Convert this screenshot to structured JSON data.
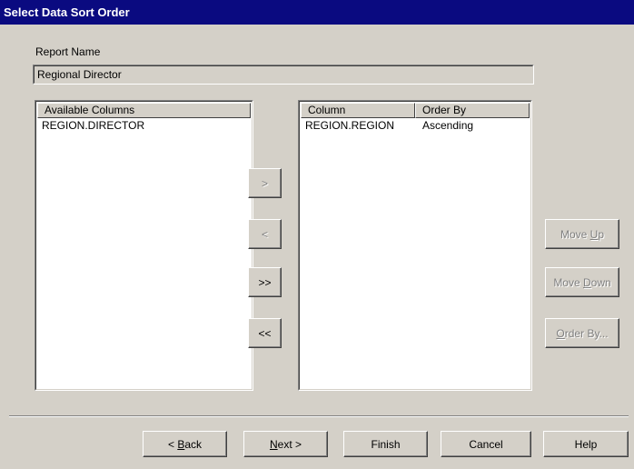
{
  "window": {
    "title": "Select Data Sort Order"
  },
  "report": {
    "label": "Report Name",
    "value": "Regional Director"
  },
  "available": {
    "header": "Available Columns",
    "items": [
      "REGION.DIRECTOR"
    ]
  },
  "selected": {
    "headers": {
      "column": "Column",
      "order_by": "Order By"
    },
    "rows": [
      {
        "column": "REGION.REGION",
        "order_by": "Ascending"
      }
    ]
  },
  "transfer": {
    "add": ">",
    "remove": "<",
    "add_all": ">>",
    "remove_all": "<<"
  },
  "side": {
    "move_up": "Move Up",
    "move_down": "Move Down",
    "order_by": "Order By..."
  },
  "footer": {
    "back": "< Back",
    "next": "Next >",
    "finish": "Finish",
    "cancel": "Cancel",
    "help": "Help"
  }
}
